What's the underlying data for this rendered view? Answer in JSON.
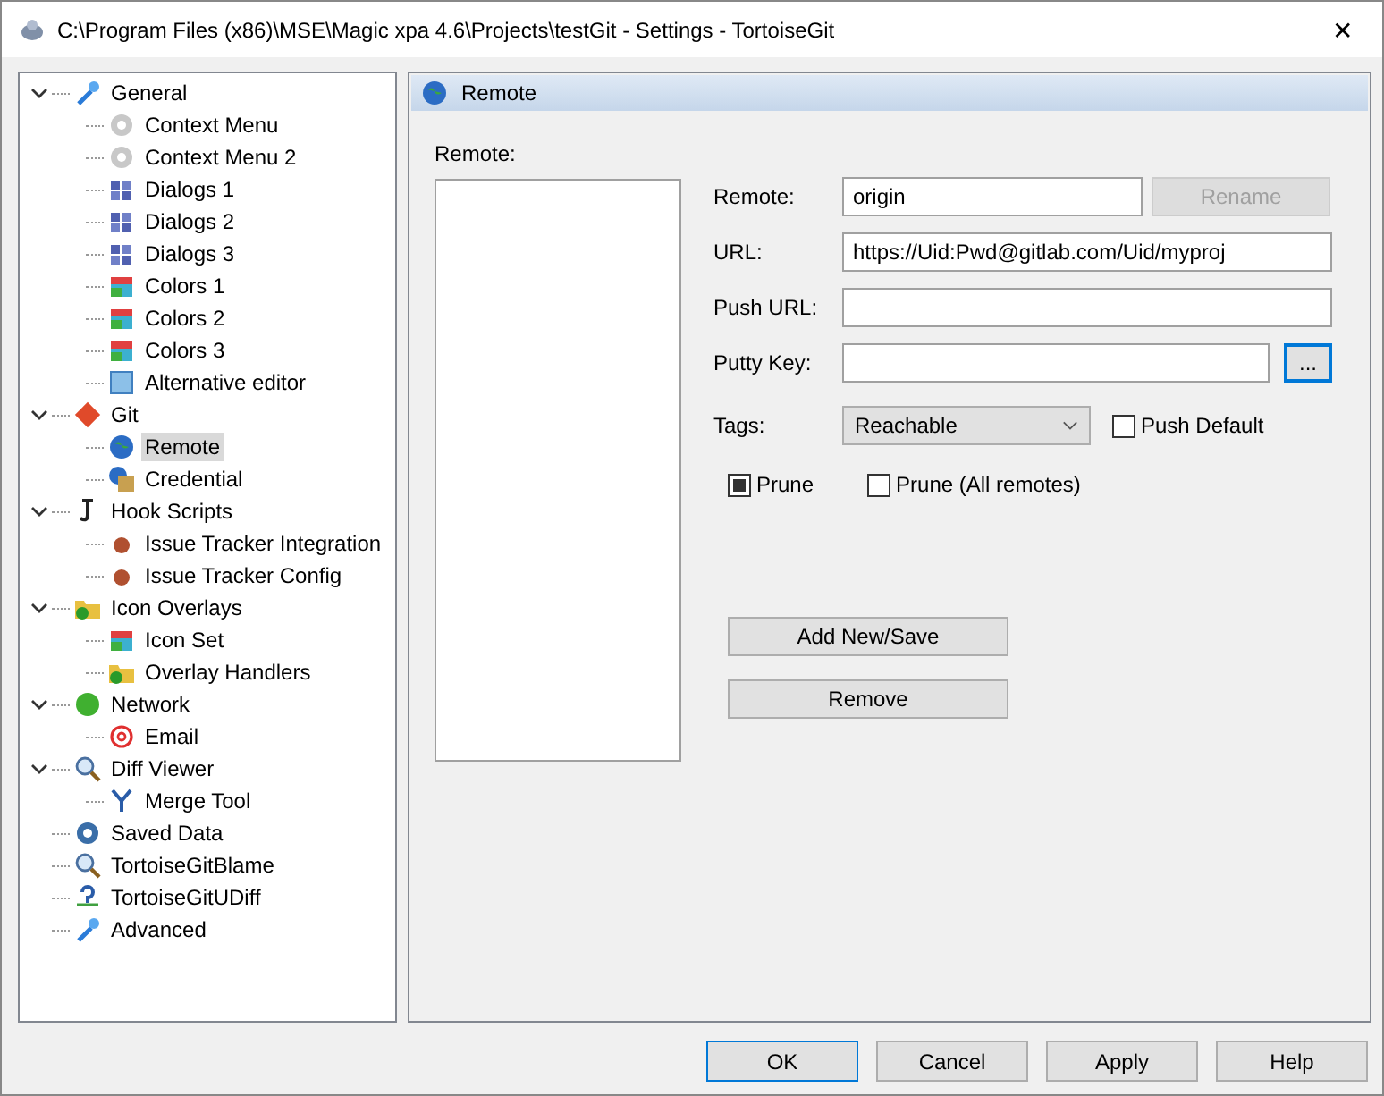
{
  "window": {
    "title": "C:\\Program Files (x86)\\MSE\\Magic xpa 4.6\\Projects\\testGit - Settings - TortoiseGit",
    "close": "✕"
  },
  "tree": [
    {
      "label": "General",
      "selected": false,
      "expanded": true,
      "children": [
        {
          "label": "Context Menu",
          "selected": false
        },
        {
          "label": "Context Menu 2",
          "selected": false
        },
        {
          "label": "Dialogs 1",
          "selected": false
        },
        {
          "label": "Dialogs 2",
          "selected": false
        },
        {
          "label": "Dialogs 3",
          "selected": false
        },
        {
          "label": "Colors 1",
          "selected": false
        },
        {
          "label": "Colors 2",
          "selected": false
        },
        {
          "label": "Colors 3",
          "selected": false
        },
        {
          "label": "Alternative editor",
          "selected": false
        }
      ]
    },
    {
      "label": "Git",
      "selected": false,
      "expanded": true,
      "children": [
        {
          "label": "Remote",
          "selected": true
        },
        {
          "label": "Credential",
          "selected": false
        }
      ]
    },
    {
      "label": "Hook Scripts",
      "selected": false,
      "expanded": true,
      "children": [
        {
          "label": "Issue Tracker Integration",
          "selected": false
        },
        {
          "label": "Issue Tracker Config",
          "selected": false
        }
      ]
    },
    {
      "label": "Icon Overlays",
      "selected": false,
      "expanded": true,
      "children": [
        {
          "label": "Icon Set",
          "selected": false
        },
        {
          "label": "Overlay Handlers",
          "selected": false
        }
      ]
    },
    {
      "label": "Network",
      "selected": false,
      "expanded": true,
      "children": [
        {
          "label": "Email",
          "selected": false
        }
      ]
    },
    {
      "label": "Diff Viewer",
      "selected": false,
      "expanded": true,
      "children": [
        {
          "label": "Merge Tool",
          "selected": false
        }
      ]
    },
    {
      "label": "Saved Data",
      "selected": false
    },
    {
      "label": "TortoiseGitBlame",
      "selected": false
    },
    {
      "label": "TortoiseGitUDiff",
      "selected": false
    },
    {
      "label": "Advanced",
      "selected": false
    }
  ],
  "page_title": "Remote",
  "remote_list_label": "Remote:",
  "fields": {
    "remote_label": "Remote:",
    "remote_value": "origin",
    "rename": "Rename",
    "rename_disabled": true,
    "url_label": "URL:",
    "url_value": "https://Uid:Pwd@gitlab.com/Uid/myproj",
    "push_url_label": "Push URL:",
    "putty_label": "Putty Key:",
    "browse": "...",
    "tags_label": "Tags:",
    "tags_value": "Reachable"
  },
  "checks": [
    {
      "label": "Push Default",
      "checked": false
    },
    {
      "label": "Prune",
      "checked": true
    },
    {
      "label": "Prune (All remotes)",
      "checked": false
    }
  ],
  "actions": [
    "Add New/Save",
    "Remove"
  ],
  "buttons": [
    "OK",
    "Cancel",
    "Apply",
    "Help"
  ]
}
